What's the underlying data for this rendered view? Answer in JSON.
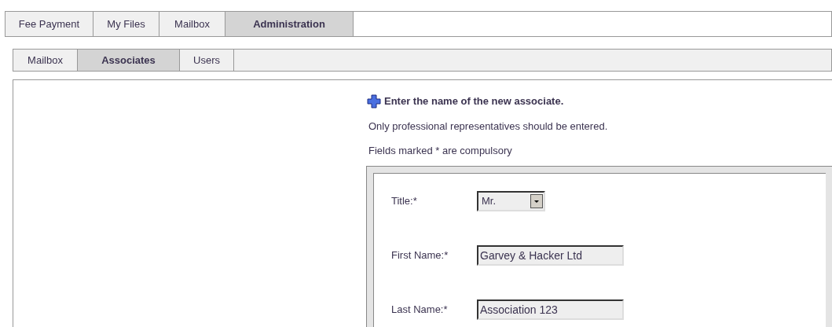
{
  "main_tabs": [
    {
      "label": "Fee Payment",
      "selected": false
    },
    {
      "label": "My Files",
      "selected": false
    },
    {
      "label": "Mailbox",
      "selected": false
    },
    {
      "label": "Administration",
      "selected": true
    }
  ],
  "sub_tabs": [
    {
      "label": "Mailbox",
      "selected": false
    },
    {
      "label": "Associates",
      "selected": true
    },
    {
      "label": "Users",
      "selected": false
    }
  ],
  "heading": "Enter the name of the new associate.",
  "notes": [
    "Only professional representatives should be entered.",
    "Fields marked * are compulsory"
  ],
  "form": [
    {
      "kind": "select",
      "label": "Title:*",
      "value": "Mr."
    },
    {
      "kind": "text",
      "label": "First Name:*",
      "value": "Garvey & Hacker Ltd"
    },
    {
      "kind": "text",
      "label": "Last Name:*",
      "value": "Association 123"
    }
  ]
}
